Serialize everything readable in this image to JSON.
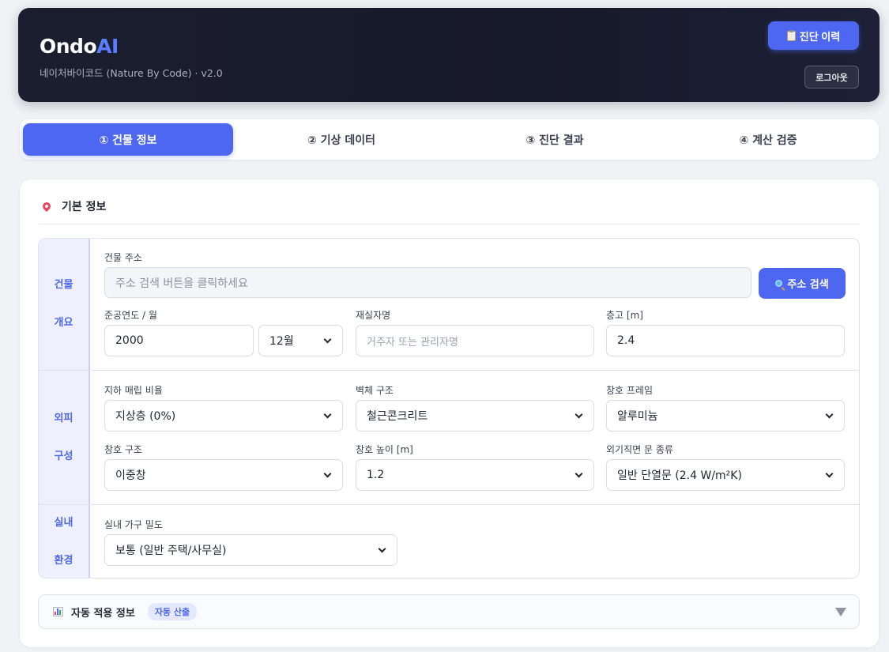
{
  "header": {
    "brand_main": "Ondo",
    "brand_accent": "AI",
    "subtitle": "네이처바이코드 (Nature By Code) · v2.0",
    "history_button": "진단 이력",
    "logout_button": "로그아웃"
  },
  "tabs": [
    {
      "label": "① 건물 정보",
      "active": true
    },
    {
      "label": "② 기상 데이터",
      "active": false
    },
    {
      "label": "③ 진단 결과",
      "active": false
    },
    {
      "label": "④ 계산 검증",
      "active": false
    }
  ],
  "section": {
    "title": "기본 정보",
    "icon": "pin-icon"
  },
  "groups": {
    "overview": {
      "label_1": "건물",
      "label_2": "개요"
    },
    "envelope": {
      "label_1": "외피",
      "label_2": "구성"
    },
    "indoor": {
      "label_1": "실내",
      "label_2": "환경"
    }
  },
  "fields": {
    "address": {
      "label": "건물 주소",
      "placeholder": "주소 검색 버튼을 클릭하세요",
      "button": "주소 검색"
    },
    "completion": {
      "label": "준공연도 / 월",
      "year": "2000",
      "month": "12월"
    },
    "occupant": {
      "label": "재실자명",
      "placeholder": "거주자 또는 관리자명"
    },
    "floor_height": {
      "label": "층고 [m]",
      "value": "2.4"
    },
    "underground_ratio": {
      "label": "지하 매립 비율",
      "value": "지상층 (0%)"
    },
    "wall_structure": {
      "label": "벽체 구조",
      "value": "철근콘크리트"
    },
    "window_frame": {
      "label": "창호 프레임",
      "value": "알루미늄"
    },
    "window_structure": {
      "label": "창호 구조",
      "value": "이중창"
    },
    "window_height": {
      "label": "창호 높이 [m]",
      "value": "1.2"
    },
    "door_type": {
      "label": "외기직면 문 종류",
      "value": "일반 단열문 (2.4 W/m²K)"
    },
    "furniture_density": {
      "label": "실내 가구 밀도",
      "value": "보통 (일반 주택/사무실)"
    }
  },
  "auto_info": {
    "title": "자동 적용 정보",
    "badge": "자동 산출"
  },
  "colors": {
    "accent": "#4e67f0",
    "header_bg": "#1b1e2e",
    "page_bg": "#f0f2f6"
  }
}
